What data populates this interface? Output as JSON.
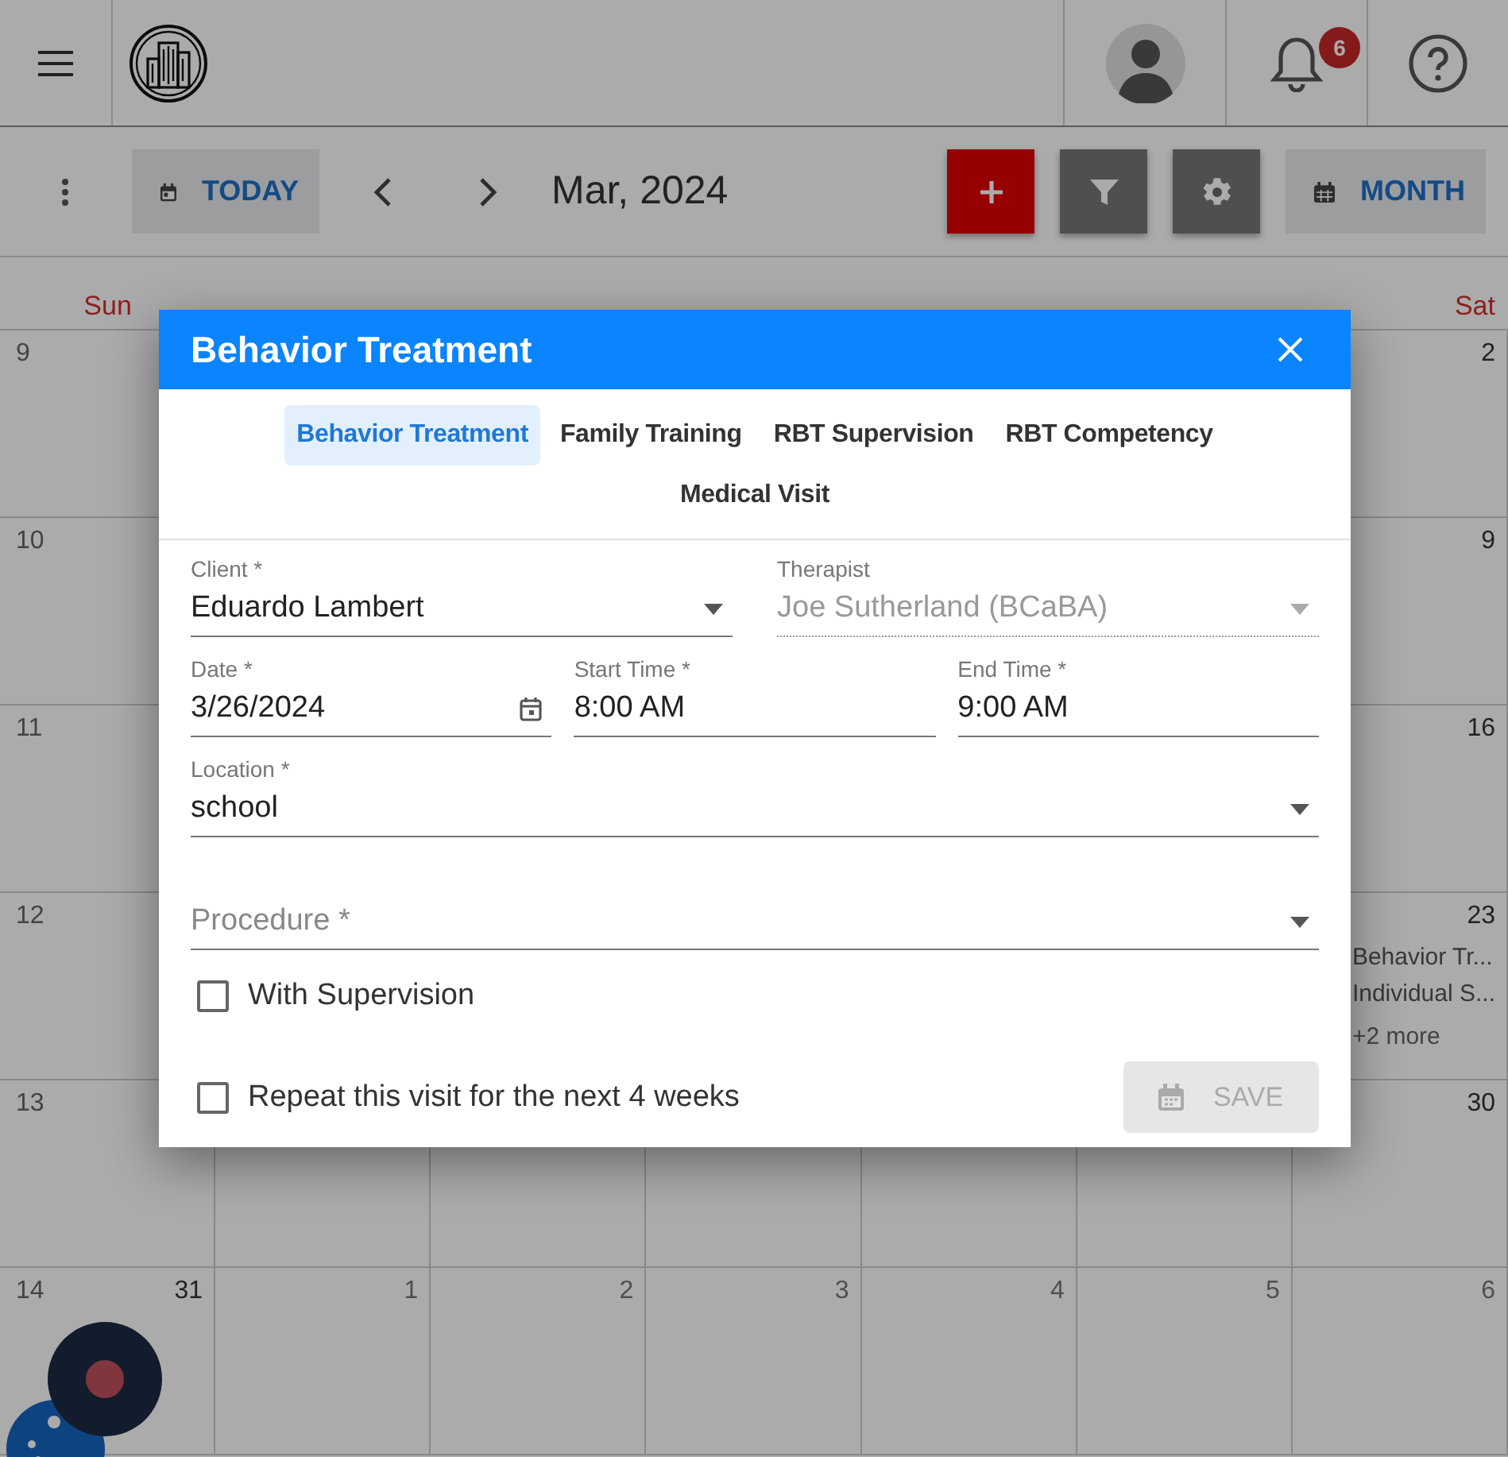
{
  "header": {
    "notification_count": "6"
  },
  "toolbar": {
    "today": "TODAY",
    "month_label": "Mar, 2024",
    "view": "MONTH"
  },
  "calendar": {
    "weekdays": {
      "sun": {
        "label": "Sun",
        "weekend": true
      },
      "sat": {
        "label": "Sat",
        "weekend": true
      }
    },
    "weeks": [
      {
        "number": "9",
        "sat": {
          "date": "2",
          "outside": false
        }
      },
      {
        "number": "10",
        "sat": {
          "date": "9",
          "outside": false
        }
      },
      {
        "number": "11",
        "sat": {
          "date": "16",
          "outside": false
        }
      },
      {
        "number": "12",
        "sat": {
          "date": "23",
          "outside": false,
          "events": [
            {
              "title": "Behavior Tr...",
              "icon": false
            },
            {
              "title": "Individual S...",
              "icon": false
            }
          ],
          "more": "+2 more"
        }
      },
      {
        "number": "13",
        "sat": {
          "date": "30",
          "outside": false
        }
      },
      {
        "number": "14",
        "sun": {
          "date": "31",
          "outside": false
        },
        "mon": {
          "date": "1",
          "outside": true
        },
        "tue": {
          "date": "2",
          "outside": true
        },
        "wed": {
          "date": "3",
          "outside": true
        },
        "thu": {
          "date": "4",
          "outside": true
        },
        "fri": {
          "date": "5",
          "outside": true
        },
        "sat": {
          "date": "6",
          "outside": true
        }
      }
    ]
  },
  "dialog": {
    "title": "Behavior Treatment",
    "tabs": [
      {
        "label": "Behavior Treatment",
        "selected": true
      },
      {
        "label": "Family Training",
        "selected": false
      },
      {
        "label": "RBT Supervision",
        "selected": false
      },
      {
        "label": "RBT Competency",
        "selected": false
      },
      {
        "label": "Medical Visit",
        "selected": false
      }
    ],
    "field_rows": [
      [
        {
          "label": "Client *",
          "value": "Eduardo Lambert",
          "kind": "select",
          "disabled": false
        },
        {
          "label": "Therapist",
          "value": "Joe Sutherland (BCaBA)",
          "kind": "select",
          "disabled": true
        }
      ],
      [
        {
          "label": "Date *",
          "value": "3/26/2024",
          "kind": "date",
          "disabled": false
        },
        {
          "label": "Start Time *",
          "value": "8:00 AM",
          "kind": "time",
          "disabled": false
        },
        {
          "label": "End Time *",
          "value": "9:00 AM",
          "kind": "time",
          "disabled": false
        }
      ],
      [
        {
          "label": "Location *",
          "value": "school",
          "kind": "select",
          "disabled": false
        }
      ],
      [
        {
          "placeholder": "Procedure *",
          "kind": "select",
          "disabled": false
        }
      ]
    ],
    "supervision": {
      "label": "With Supervision",
      "checked": false
    },
    "repeat": {
      "label": "Repeat this visit for the next 4 weeks",
      "checked": false
    },
    "save": {
      "label": "SAVE",
      "disabled": true
    }
  }
}
